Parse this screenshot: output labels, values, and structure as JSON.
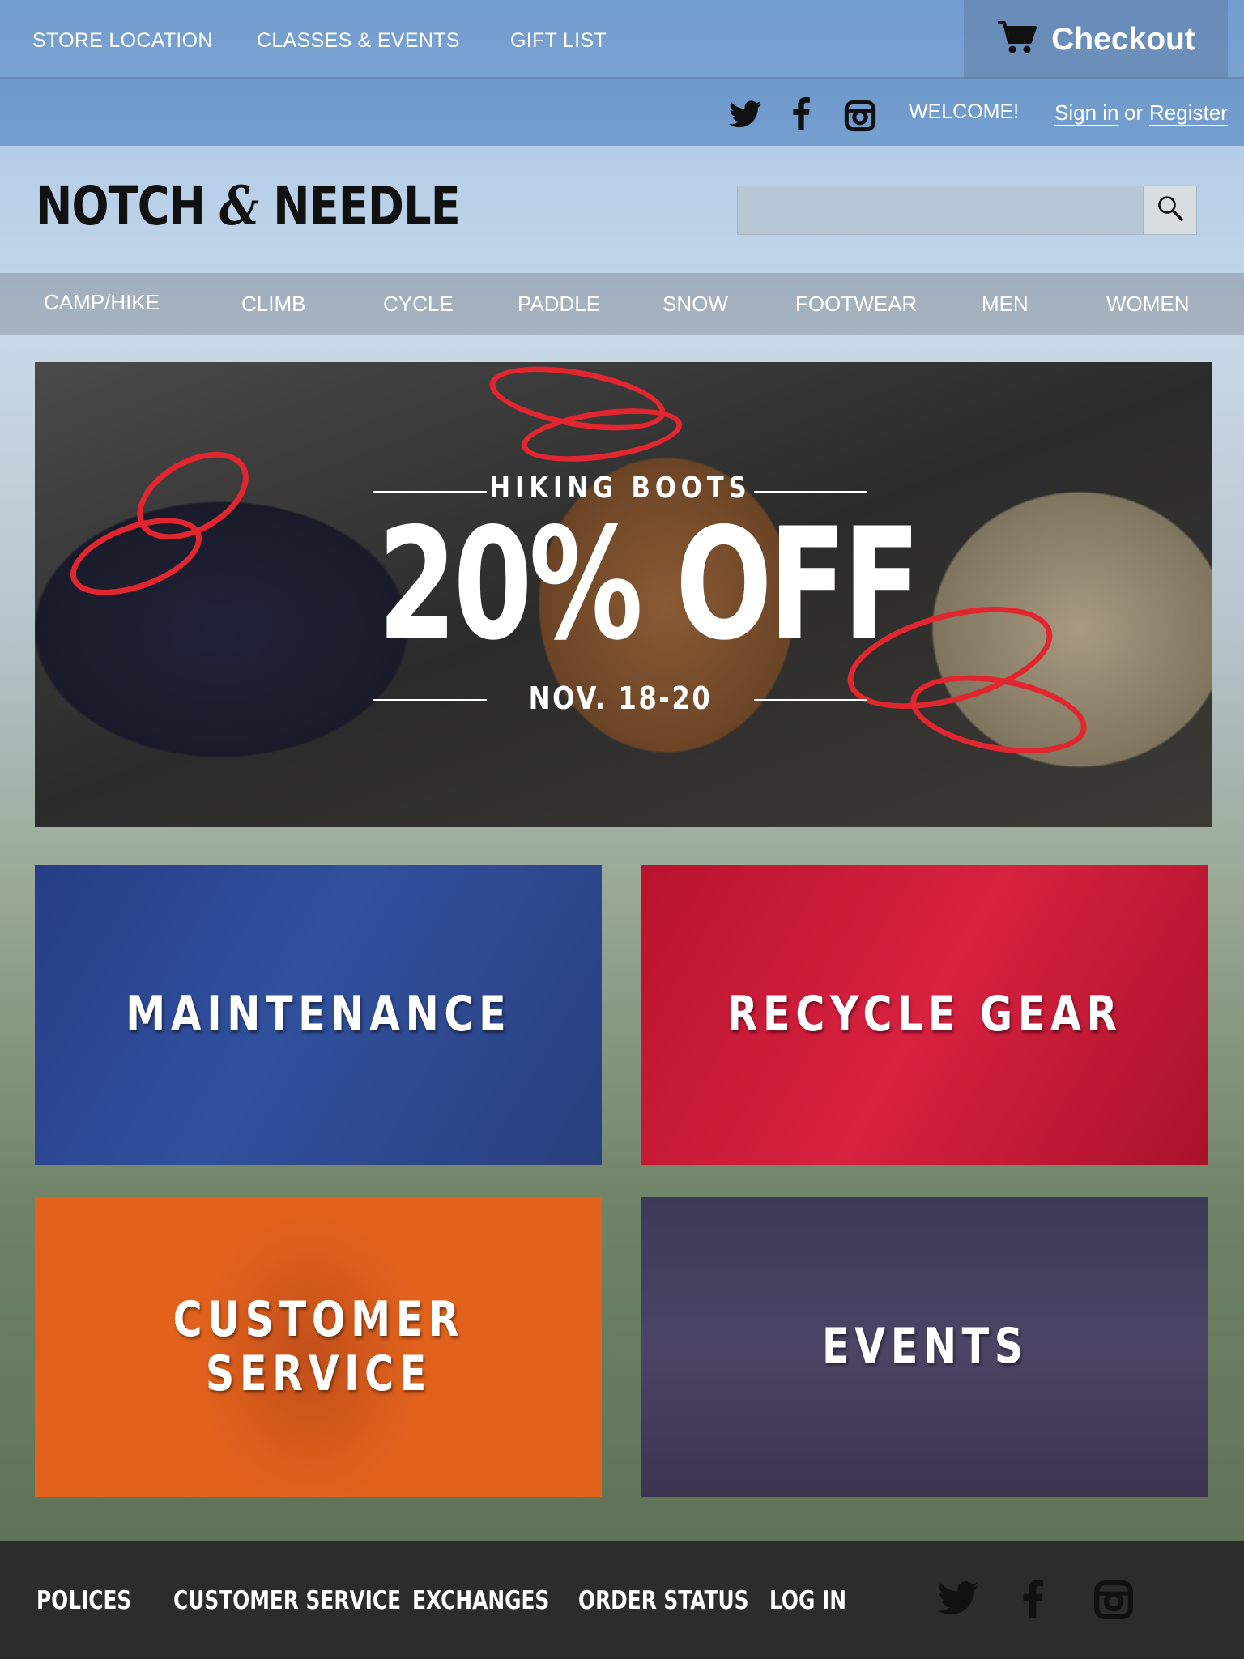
{
  "top_nav": {
    "links": [
      "STORE LOCATION",
      "CLASSES & EVENTS",
      "GIFT LIST"
    ],
    "checkout_label": "Checkout"
  },
  "account": {
    "welcome": "WELCOME!",
    "sign_in": "Sign in",
    "or": "or",
    "register": "Register"
  },
  "brand": {
    "name_part1": "NOTCH",
    "name_amp": "&",
    "name_part2": "NEEDLE"
  },
  "search": {
    "placeholder": "",
    "value": ""
  },
  "categories": [
    "CAMP/HIKE",
    "CLIMB",
    "CYCLE",
    "PADDLE",
    "SNOW",
    "FOOTWEAR",
    "MEN",
    "WOMEN"
  ],
  "hero": {
    "kicker": "HIKING BOOTS",
    "headline": "20% OFF",
    "dates": "NOV. 18-20"
  },
  "tiles": {
    "maintenance": "MAINTENANCE",
    "recycle": "RECYCLE GEAR",
    "customer_service_line1": "CUSTOMER",
    "customer_service_line2": "SERVICE",
    "events": "EVENTS"
  },
  "footer": {
    "links": [
      "POLICES",
      "CUSTOMER SERVICE",
      "EXCHANGES",
      "ORDER STATUS",
      "LOG IN"
    ]
  },
  "icons": {
    "cart": "cart-icon",
    "twitter": "twitter-icon",
    "facebook": "facebook-icon",
    "instagram": "instagram-icon",
    "search": "search-icon"
  },
  "colors": {
    "maintenance_tile": "#30509d",
    "recycle_tile": "#d7213f",
    "customer_service_tile": "#e3611d",
    "events_tile": "#4b4466",
    "footer": "#2c2d2b",
    "lace_red": "#e1262f"
  }
}
